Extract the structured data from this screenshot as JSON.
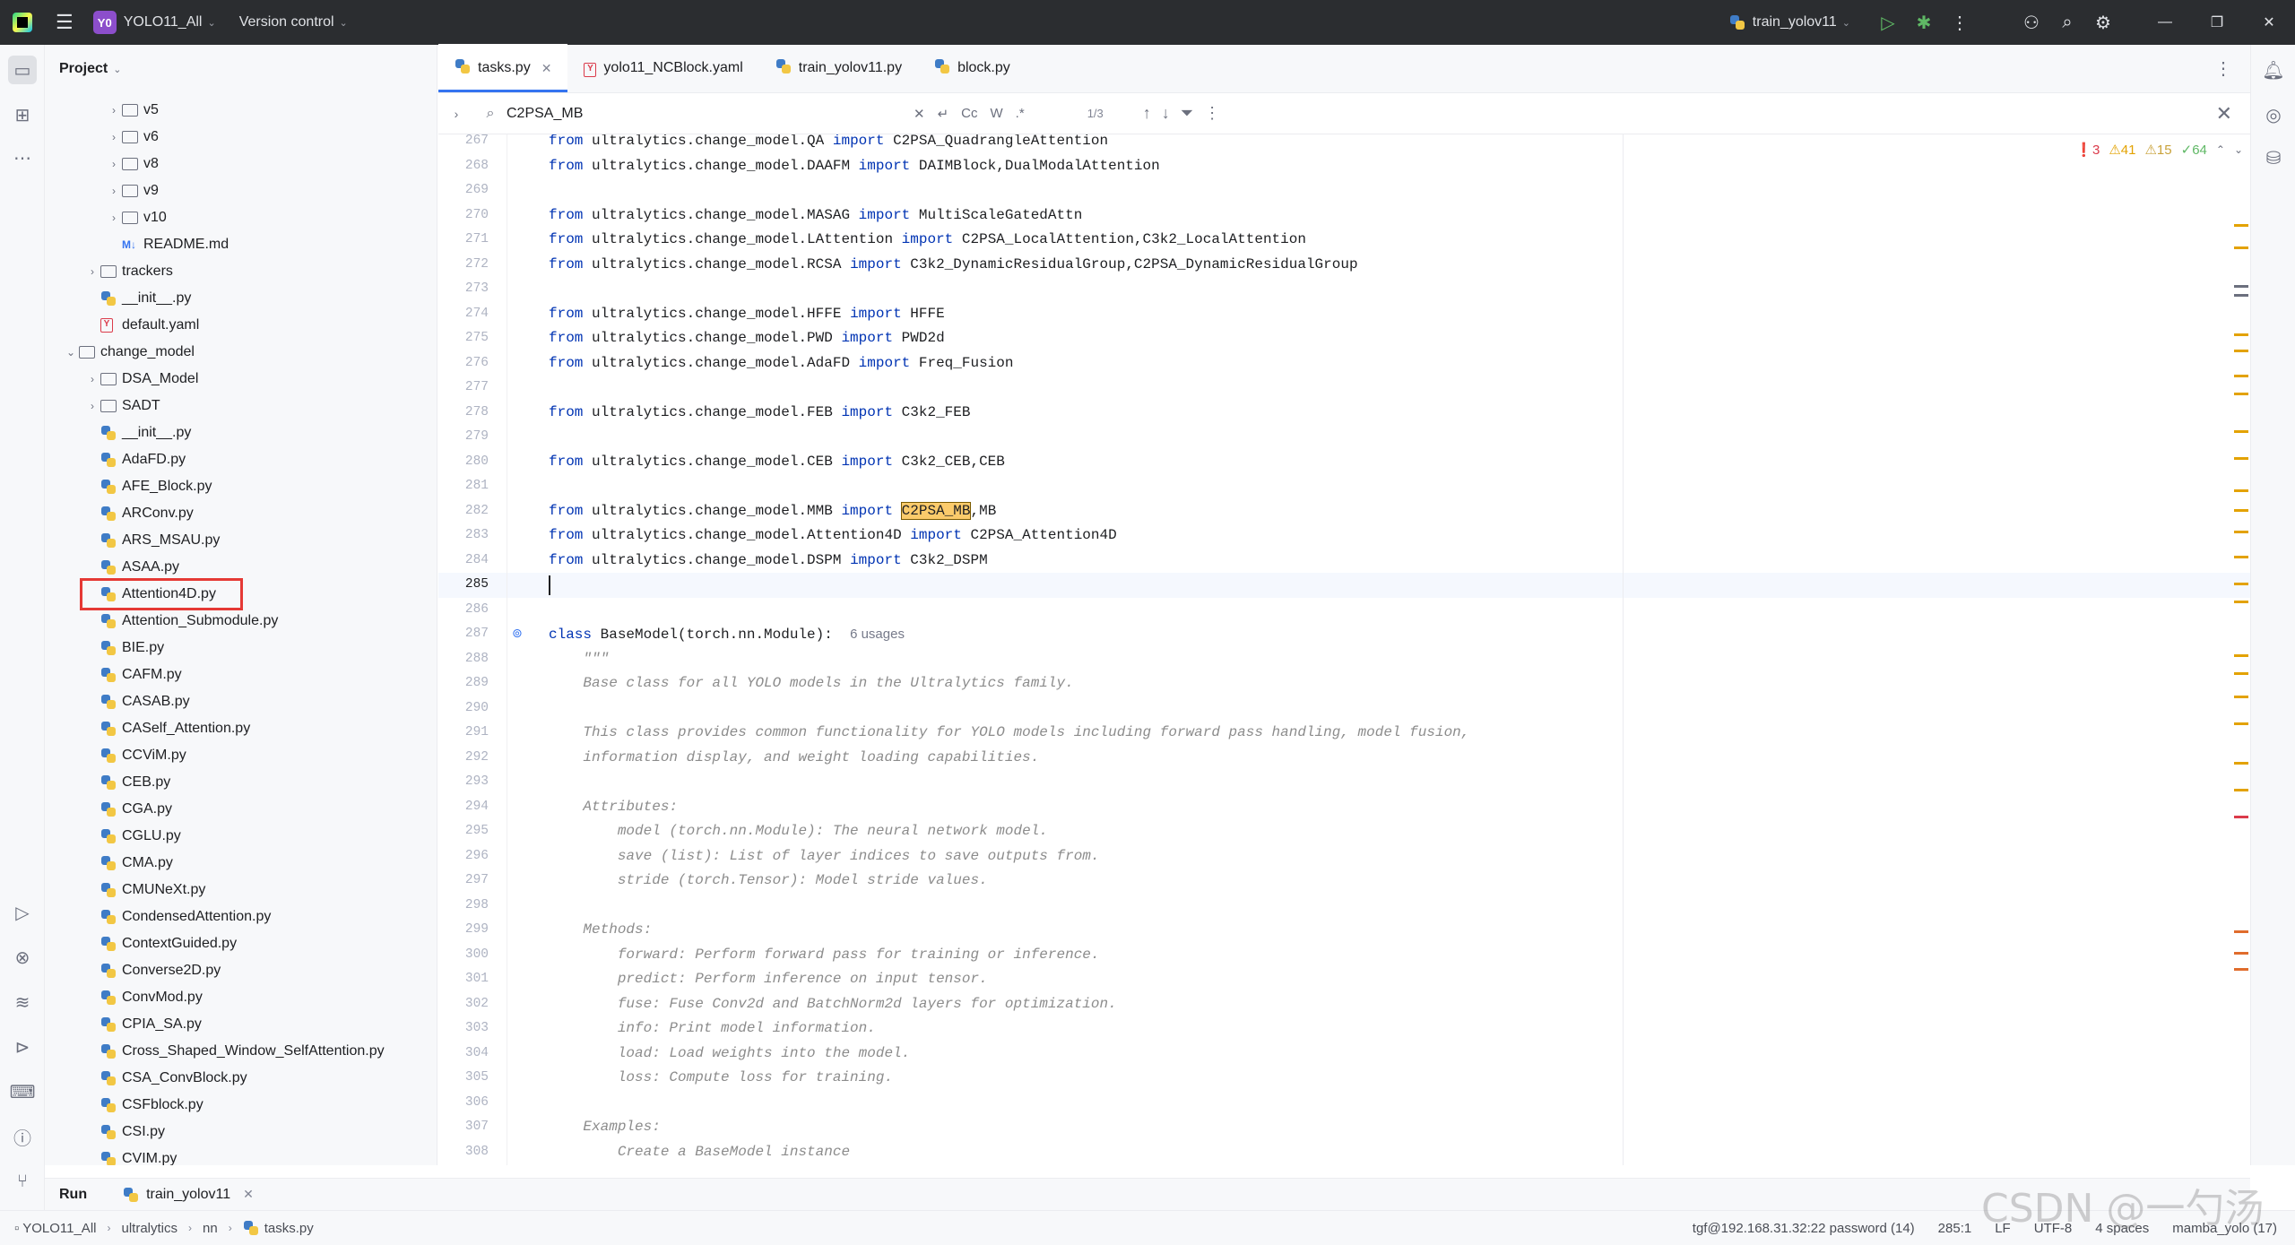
{
  "titlebar": {
    "project_badge": "Y0",
    "project_name": "YOLO11_All",
    "version_control": "Version control",
    "run_config": "train_yolov11"
  },
  "project_panel": {
    "title": "Project",
    "items": [
      {
        "label": "v5",
        "type": "folder",
        "level": 2,
        "expandable": true
      },
      {
        "label": "v6",
        "type": "folder",
        "level": 2,
        "expandable": true
      },
      {
        "label": "v8",
        "type": "folder",
        "level": 2,
        "expandable": true
      },
      {
        "label": "v9",
        "type": "folder",
        "level": 2,
        "expandable": true
      },
      {
        "label": "v10",
        "type": "folder",
        "level": 2,
        "expandable": true
      },
      {
        "label": "README.md",
        "type": "md",
        "level": 2,
        "expandable": false
      },
      {
        "label": "trackers",
        "type": "folder",
        "level": 1,
        "expandable": true
      },
      {
        "label": "__init__.py",
        "type": "py",
        "level": 1,
        "expandable": false
      },
      {
        "label": "default.yaml",
        "type": "yaml",
        "level": 1,
        "expandable": false
      },
      {
        "label": "change_model",
        "type": "folder",
        "level": 0,
        "expandable": true,
        "expanded": true
      },
      {
        "label": "DSA_Model",
        "type": "folder",
        "level": 1,
        "expandable": true
      },
      {
        "label": "SADT",
        "type": "folder",
        "level": 1,
        "expandable": true
      },
      {
        "label": "__init__.py",
        "type": "py",
        "level": 1,
        "expandable": false
      },
      {
        "label": "AdaFD.py",
        "type": "py",
        "level": 1,
        "expandable": false
      },
      {
        "label": "AFE_Block.py",
        "type": "py",
        "level": 1,
        "expandable": false
      },
      {
        "label": "ARConv.py",
        "type": "py",
        "level": 1,
        "expandable": false
      },
      {
        "label": "ARS_MSAU.py",
        "type": "py",
        "level": 1,
        "expandable": false
      },
      {
        "label": "ASAA.py",
        "type": "py",
        "level": 1,
        "expandable": false
      },
      {
        "label": "Attention4D.py",
        "type": "py",
        "level": 1,
        "expandable": false,
        "highlight": true
      },
      {
        "label": "Attention_Submodule.py",
        "type": "py",
        "level": 1,
        "expandable": false
      },
      {
        "label": "BIE.py",
        "type": "py",
        "level": 1,
        "expandable": false
      },
      {
        "label": "CAFM.py",
        "type": "py",
        "level": 1,
        "expandable": false
      },
      {
        "label": "CASAB.py",
        "type": "py",
        "level": 1,
        "expandable": false
      },
      {
        "label": "CASelf_Attention.py",
        "type": "py",
        "level": 1,
        "expandable": false
      },
      {
        "label": "CCViM.py",
        "type": "py",
        "level": 1,
        "expandable": false
      },
      {
        "label": "CEB.py",
        "type": "py",
        "level": 1,
        "expandable": false
      },
      {
        "label": "CGA.py",
        "type": "py",
        "level": 1,
        "expandable": false
      },
      {
        "label": "CGLU.py",
        "type": "py",
        "level": 1,
        "expandable": false
      },
      {
        "label": "CMA.py",
        "type": "py",
        "level": 1,
        "expandable": false
      },
      {
        "label": "CMUNeXt.py",
        "type": "py",
        "level": 1,
        "expandable": false
      },
      {
        "label": "CondensedAttention.py",
        "type": "py",
        "level": 1,
        "expandable": false
      },
      {
        "label": "ContextGuided.py",
        "type": "py",
        "level": 1,
        "expandable": false
      },
      {
        "label": "Converse2D.py",
        "type": "py",
        "level": 1,
        "expandable": false
      },
      {
        "label": "ConvMod.py",
        "type": "py",
        "level": 1,
        "expandable": false
      },
      {
        "label": "CPIA_SA.py",
        "type": "py",
        "level": 1,
        "expandable": false
      },
      {
        "label": "Cross_Shaped_Window_SelfAttention.py",
        "type": "py",
        "level": 1,
        "expandable": false
      },
      {
        "label": "CSA_ConvBlock.py",
        "type": "py",
        "level": 1,
        "expandable": false
      },
      {
        "label": "CSFblock.py",
        "type": "py",
        "level": 1,
        "expandable": false
      },
      {
        "label": "CSI.py",
        "type": "py",
        "level": 1,
        "expandable": false
      },
      {
        "label": "CVIM.py",
        "type": "py",
        "level": 1,
        "expandable": false
      }
    ]
  },
  "tabs": [
    {
      "label": "tasks.py",
      "icon": "python-file-icon",
      "active": true
    },
    {
      "label": "yolo11_NCBlock.yaml",
      "icon": "yaml-file-icon",
      "active": false
    },
    {
      "label": "train_yolov11.py",
      "icon": "python-file-icon",
      "active": false
    },
    {
      "label": "block.py",
      "icon": "python-file-icon",
      "active": false
    }
  ],
  "search": {
    "query": "C2PSA_MB",
    "match_case": "Cc",
    "words": "W",
    "regex": ".*",
    "count": "1/3"
  },
  "inspections": {
    "errors": "3",
    "warnings": "41",
    "weak_warnings": "15",
    "ok": "64"
  },
  "code": {
    "lines": [
      {
        "num": "267",
        "segments": [
          [
            "kw",
            "from"
          ],
          [
            "t",
            " ultralytics.change_model.QA "
          ],
          [
            "kw",
            "import"
          ],
          [
            "t",
            " C2PSA_QuadrangleAttention"
          ]
        ]
      },
      {
        "num": "268",
        "segments": [
          [
            "kw",
            "from"
          ],
          [
            "t",
            " ultralytics.change_model.DAAFM "
          ],
          [
            "kw",
            "import"
          ],
          [
            "t",
            " DAIMBlock,DualModalAttention"
          ]
        ]
      },
      {
        "num": "269",
        "segments": []
      },
      {
        "num": "270",
        "segments": [
          [
            "kw",
            "from"
          ],
          [
            "t",
            " ultralytics.change_model.MASAG "
          ],
          [
            "kw",
            "import"
          ],
          [
            "t",
            " MultiScaleGatedAttn"
          ]
        ]
      },
      {
        "num": "271",
        "segments": [
          [
            "kw",
            "from"
          ],
          [
            "t",
            " ultralytics.change_model.LAttention "
          ],
          [
            "kw",
            "import"
          ],
          [
            "t",
            " C2PSA_LocalAttention,C3k2_LocalAttention"
          ]
        ]
      },
      {
        "num": "272",
        "segments": [
          [
            "kw",
            "from"
          ],
          [
            "t",
            " ultralytics.change_model.RCSA "
          ],
          [
            "kw",
            "import"
          ],
          [
            "t",
            " C3k2_DynamicResidualGroup,C2PSA_DynamicResidualGroup"
          ]
        ]
      },
      {
        "num": "273",
        "segments": []
      },
      {
        "num": "274",
        "segments": [
          [
            "kw",
            "from"
          ],
          [
            "t",
            " ultralytics.change_model.HFFE "
          ],
          [
            "kw",
            "import"
          ],
          [
            "t",
            " HFFE"
          ]
        ]
      },
      {
        "num": "275",
        "segments": [
          [
            "kw",
            "from"
          ],
          [
            "t",
            " ultralytics.change_model.PWD "
          ],
          [
            "kw",
            "import"
          ],
          [
            "t",
            " PWD2d"
          ]
        ]
      },
      {
        "num": "276",
        "segments": [
          [
            "kw",
            "from"
          ],
          [
            "t",
            " ultralytics.change_model.AdaFD "
          ],
          [
            "kw",
            "import"
          ],
          [
            "t",
            " Freq_Fusion"
          ]
        ]
      },
      {
        "num": "277",
        "segments": []
      },
      {
        "num": "278",
        "segments": [
          [
            "kw",
            "from"
          ],
          [
            "t",
            " ultralytics.change_model.FEB "
          ],
          [
            "kw",
            "import"
          ],
          [
            "t",
            " C3k2_FEB"
          ]
        ]
      },
      {
        "num": "279",
        "segments": []
      },
      {
        "num": "280",
        "segments": [
          [
            "kw",
            "from"
          ],
          [
            "t",
            " ultralytics.change_model.CEB "
          ],
          [
            "kw",
            "import"
          ],
          [
            "t",
            " C3k2_CEB,CEB"
          ]
        ]
      },
      {
        "num": "281",
        "segments": []
      },
      {
        "num": "282",
        "segments": [
          [
            "kw",
            "from"
          ],
          [
            "t",
            " ultralytics.change_model.MMB "
          ],
          [
            "kw",
            "import"
          ],
          [
            "t",
            " "
          ],
          [
            "match",
            "C2PSA_MB"
          ],
          [
            "t",
            ",MB"
          ]
        ]
      },
      {
        "num": "283",
        "segments": [
          [
            "kw",
            "from"
          ],
          [
            "t",
            " ultralytics.change_model.Attention4D "
          ],
          [
            "kw",
            "import"
          ],
          [
            "t",
            " C2PSA_Attention4D"
          ]
        ]
      },
      {
        "num": "284",
        "segments": [
          [
            "kw",
            "from"
          ],
          [
            "t",
            " ultralytics.change_model.DSPM "
          ],
          [
            "kw",
            "import"
          ],
          [
            "t",
            " C3k2_DSPM"
          ]
        ]
      },
      {
        "num": "285",
        "segments": [],
        "current": true
      },
      {
        "num": "286",
        "segments": []
      },
      {
        "num": "287",
        "segments": [
          [
            "kw",
            "class"
          ],
          [
            "t",
            " BaseModel(torch.nn.Module):  "
          ],
          [
            "hint",
            "6 usages"
          ]
        ],
        "gutter_icon": true
      },
      {
        "num": "288",
        "segments": [
          [
            "doc",
            "    \"\"\""
          ]
        ]
      },
      {
        "num": "289",
        "segments": [
          [
            "doc",
            "    Base class for all YOLO models in the Ultralytics family."
          ]
        ]
      },
      {
        "num": "290",
        "segments": []
      },
      {
        "num": "291",
        "segments": [
          [
            "doc",
            "    This class provides common functionality for YOLO models including forward pass handling, model fusion,"
          ]
        ]
      },
      {
        "num": "292",
        "segments": [
          [
            "doc",
            "    information display, and weight loading capabilities."
          ]
        ]
      },
      {
        "num": "293",
        "segments": []
      },
      {
        "num": "294",
        "segments": [
          [
            "doc",
            "    Attributes:"
          ]
        ]
      },
      {
        "num": "295",
        "segments": [
          [
            "doc",
            "        model (torch.nn.Module): The neural network model."
          ]
        ]
      },
      {
        "num": "296",
        "segments": [
          [
            "doc",
            "        save (list): List of layer indices to save outputs from."
          ]
        ]
      },
      {
        "num": "297",
        "segments": [
          [
            "doc",
            "        stride (torch.Tensor): Model stride values."
          ]
        ]
      },
      {
        "num": "298",
        "segments": []
      },
      {
        "num": "299",
        "segments": [
          [
            "doc",
            "    Methods:"
          ]
        ]
      },
      {
        "num": "300",
        "segments": [
          [
            "doc",
            "        forward: Perform forward pass for training or inference."
          ]
        ]
      },
      {
        "num": "301",
        "segments": [
          [
            "doc",
            "        predict: Perform inference on input tensor."
          ]
        ]
      },
      {
        "num": "302",
        "segments": [
          [
            "doc",
            "        fuse: Fuse Conv2d and BatchNorm2d layers for optimization."
          ]
        ]
      },
      {
        "num": "303",
        "segments": [
          [
            "doc",
            "        info: Print model information."
          ]
        ]
      },
      {
        "num": "304",
        "segments": [
          [
            "doc",
            "        load: Load weights into the model."
          ]
        ]
      },
      {
        "num": "305",
        "segments": [
          [
            "doc",
            "        loss: Compute loss for training."
          ]
        ]
      },
      {
        "num": "306",
        "segments": []
      },
      {
        "num": "307",
        "segments": [
          [
            "doc",
            "    Examples:"
          ]
        ]
      },
      {
        "num": "308",
        "segments": [
          [
            "doc",
            "        Create a BaseModel instance"
          ]
        ]
      }
    ]
  },
  "runbar": {
    "label": "Run",
    "tab": "train_yolov11"
  },
  "statusbar": {
    "breadcrumb": [
      "YOLO11_All",
      "ultralytics",
      "nn",
      "tasks.py"
    ],
    "interpreter_remote": "tgf@192.168.31.32:22 password (14)",
    "position": "285:1",
    "line_ending": "LF",
    "encoding": "UTF-8",
    "indent": "4 spaces",
    "env": "mamba_yolo (17)"
  },
  "watermark": "CSDN @一勺汤",
  "colors": {
    "accent": "#3574f0",
    "highlight_box": "#e53935",
    "search_match": "#fbcb6b",
    "keyword": "#0033b3",
    "docstring": "#8c8c8c"
  }
}
